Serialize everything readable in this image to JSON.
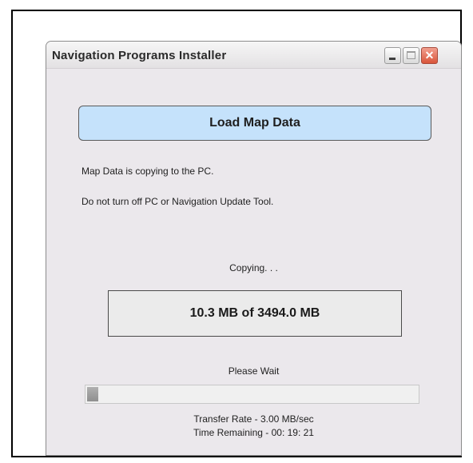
{
  "window": {
    "title": "Navigation Programs Installer",
    "close_glyph": "✕"
  },
  "header_button": {
    "label": "Load Map Data"
  },
  "messages": {
    "line1": "Map Data is copying to the PC.",
    "line2": "Do not turn off PC or Navigation Update Tool."
  },
  "copy_status": "Copying. . .",
  "size_display": "10.3 MB of 3494.0 MB",
  "wait_text": "Please Wait",
  "progress": {
    "fraction": 0.003
  },
  "transfer_rate": "Transfer Rate - 3.00 MB/sec",
  "time_remaining": "Time Remaining - 00: 19: 21",
  "icons": [
    "minimize-icon",
    "maximize-icon",
    "close-icon"
  ],
  "colors": {
    "header_button_bg": "#c5e2fb",
    "close_button": "#d9553a"
  }
}
